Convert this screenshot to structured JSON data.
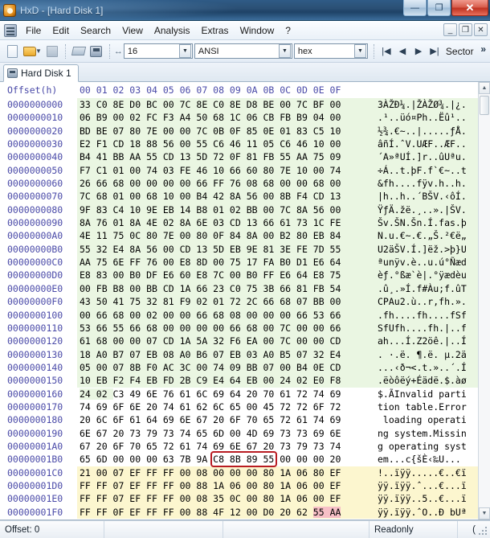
{
  "window": {
    "title": "HxD - [Hard Disk 1]",
    "app_icon": "hxd-app-icon",
    "buttons": {
      "minimize": "—",
      "maximize": "❐",
      "close": "✕"
    }
  },
  "menubar": {
    "items": [
      "File",
      "Edit",
      "Search",
      "View",
      "Analysis",
      "Extras",
      "Window",
      "?"
    ],
    "mdi_buttons": {
      "minimize": "_",
      "restore": "❐",
      "close": "✕"
    }
  },
  "toolbar": {
    "icons": [
      "new-file-icon",
      "open-file-icon",
      "save-icon",
      "open-ram-icon",
      "open-disk-icon",
      "bytes-per-row-icon"
    ],
    "bytes_per_row": {
      "value": "16",
      "label": "bytes per row"
    },
    "charset": {
      "value": "ANSI",
      "label": "character set"
    },
    "base": {
      "value": "hex",
      "label": "offset base"
    },
    "nav": {
      "first": "|◀",
      "prev": "◀",
      "next": "▶",
      "last": "▶|"
    },
    "sector_label": "Sector",
    "overflow": "»"
  },
  "tabs": [
    {
      "label": "Hard Disk 1",
      "icon": "disk-icon",
      "active": true
    }
  ],
  "hexview": {
    "header": {
      "offset_label": "Offset(h)",
      "columns": [
        "00",
        "01",
        "02",
        "03",
        "04",
        "05",
        "06",
        "07",
        "08",
        "09",
        "0A",
        "0B",
        "0C",
        "0D",
        "0E",
        "0F"
      ]
    },
    "rows": [
      {
        "offset": "0000000000",
        "hex": "33 C0 8E D0 BC 00 7C 8E C0 8E D8 BE 00 7C BF 00",
        "ascii": "3ÀŽÐ¼.|ŽÀŽØ¾.|¿.",
        "tint": "green"
      },
      {
        "offset": "0000000010",
        "hex": "06 B9 00 02 FC F3 A4 50 68 1C 06 CB FB B9 04 00",
        "ascii": ".¹..üó¤Ph..Ëû¹..",
        "tint": "green"
      },
      {
        "offset": "0000000020",
        "hex": "BD BE 07 80 7E 00 00 7C 0B 0F 85 0E 01 83 C5 10",
        "ascii": "½¾.€~..|.....ƒÅ.",
        "tint": "green"
      },
      {
        "offset": "0000000030",
        "hex": "E2 F1 CD 18 88 56 00 55 C6 46 11 05 C6 46 10 00",
        "ascii": "âñÍ.ˆV.UÆF..ÆF..",
        "tint": "green"
      },
      {
        "offset": "0000000040",
        "hex": "B4 41 BB AA 55 CD 13 5D 72 0F 81 FB 55 AA 75 09",
        "ascii": "´A»ªUÍ.]r..ûUªu.",
        "tint": "green"
      },
      {
        "offset": "0000000050",
        "hex": "F7 C1 01 00 74 03 FE 46 10 66 60 80 7E 10 00 74",
        "ascii": "÷Á..t.þF.f`€~..t",
        "tint": "green"
      },
      {
        "offset": "0000000060",
        "hex": "26 66 68 00 00 00 00 66 FF 76 08 68 00 00 68 00",
        "ascii": "&fh....fÿv.h..h.",
        "tint": "green"
      },
      {
        "offset": "0000000070",
        "hex": "7C 68 01 00 68 10 00 B4 42 8A 56 00 8B F4 CD 13",
        "ascii": "|h..h..´BŠV.‹ôÍ.",
        "tint": "green"
      },
      {
        "offset": "0000000080",
        "hex": "9F 83 C4 10 9E EB 14 B8 01 02 BB 00 7C 8A 56 00",
        "ascii": "ŸƒÄ.žë.¸..».|ŠV.",
        "tint": "green"
      },
      {
        "offset": "0000000090",
        "hex": "8A 76 01 8A 4E 02 8A 6E 03 CD 13 66 61 73 1C FE",
        "ascii": "Šv.ŠN.Šn.Í.fas.þ",
        "tint": "green"
      },
      {
        "offset": "00000000A0",
        "hex": "4E 11 75 0C 80 7E 00 80 0F 84 8A 00 B2 80 EB 84",
        "ascii": "N.u.€~.€.„Š.²€ë„",
        "tint": "green"
      },
      {
        "offset": "00000000B0",
        "hex": "55 32 E4 8A 56 00 CD 13 5D EB 9E 81 3E FE 7D 55",
        "ascii": "U2äŠV.Í.]ëž.>þ}U",
        "tint": "green"
      },
      {
        "offset": "00000000C0",
        "hex": "AA 75 6E FF 76 00 E8 8D 00 75 17 FA B0 D1 E6 64",
        "ascii": "ªunÿv.è..u.ú°Ñæd",
        "tint": "green"
      },
      {
        "offset": "00000000D0",
        "hex": "E8 83 00 B0 DF E6 60 E8 7C 00 B0 FF E6 64 E8 75",
        "ascii": "èƒ.°ßæ`è|.°ÿædèu",
        "tint": "green"
      },
      {
        "offset": "00000000E0",
        "hex": "00 FB B8 00 BB CD 1A 66 23 C0 75 3B 66 81 FB 54",
        "ascii": ".û¸.»Í.f#Àu;f.ûT",
        "tint": "green"
      },
      {
        "offset": "00000000F0",
        "hex": "43 50 41 75 32 81 F9 02 01 72 2C 66 68 07 BB 00",
        "ascii": "CPAu2.ù..r,fh.».",
        "tint": "green"
      },
      {
        "offset": "0000000100",
        "hex": "00 66 68 00 02 00 00 66 68 08 00 00 00 66 53 66",
        "ascii": ".fh....fh....fSf",
        "tint": "green"
      },
      {
        "offset": "0000000110",
        "hex": "53 66 55 66 68 00 00 00 00 66 68 00 7C 00 00 66",
        "ascii": "SfUfh....fh.|..f",
        "tint": "green"
      },
      {
        "offset": "0000000120",
        "hex": "61 68 00 00 07 CD 1A 5A 32 F6 EA 00 7C 00 00 CD",
        "ascii": "ah...Í.Z2öê.|..Í",
        "tint": "green"
      },
      {
        "offset": "0000000130",
        "hex": "18 A0 B7 07 EB 08 A0 B6 07 EB 03 A0 B5 07 32 E4",
        "ascii": ". ·.ë. ¶.ë. µ.2ä",
        "tint": "green"
      },
      {
        "offset": "0000000140",
        "hex": "05 00 07 8B F0 AC 3C 00 74 09 BB 07 00 B4 0E CD",
        "ascii": "...‹ð¬<.t.»..´.Í",
        "tint": "green"
      },
      {
        "offset": "0000000150",
        "hex": "10 EB F2 F4 EB FD 2B C9 E4 64 EB 00 24 02 E0 F8",
        "ascii": ".ëòôëý+Éädë.$.àø",
        "tint": "green"
      },
      {
        "offset": "0000000160",
        "hex": "24 02 C3 49 6E 76 61 6C 69 64 20 70 61 72 74 69",
        "ascii": "$.ÃInvalid parti",
        "tint": "green-partial"
      },
      {
        "offset": "0000000170",
        "hex": "74 69 6F 6E 20 74 61 62 6C 65 00 45 72 72 6F 72",
        "ascii": "tion table.Error",
        "tint": "none"
      },
      {
        "offset": "0000000180",
        "hex": "20 6C 6F 61 64 69 6E 67 20 6F 70 65 72 61 74 69",
        "ascii": " loading operati",
        "tint": "none"
      },
      {
        "offset": "0000000190",
        "hex": "6E 67 20 73 79 73 74 65 6D 00 4D 69 73 73 69 6E",
        "ascii": "ng system.Missin",
        "tint": "none"
      },
      {
        "offset": "00000001A0",
        "hex": "67 20 6F 70 65 72 61 74 69 6E 67 20 73 79 73 74",
        "ascii": "g operating syst",
        "tint": "none"
      },
      {
        "offset": "00000001B0",
        "hex": "65 6D 00 00 00 63 7B 9A C8 8B 89 55 00 00 00 20",
        "ascii": "em...c{šÈ‹‰U...",
        "tint": "none"
      },
      {
        "offset": "00000001C0",
        "hex": "21 00 07 EF FF FF 00 08 00 00 00 80 1A 06 80 EF",
        "ascii": "!..ïÿÿ.....€..€ï",
        "tint": "yellow"
      },
      {
        "offset": "00000001D0",
        "hex": "FF FF 07 EF FF FF 00 88 1A 06 00 80 1A 06 00 EF",
        "ascii": "ÿÿ.ïÿÿ.ˆ...€...ï",
        "tint": "yellow"
      },
      {
        "offset": "00000001E0",
        "hex": "FF FF 07 EF FF FF 00 08 35 0C 00 80 1A 06 00 EF",
        "ascii": "ÿÿ.ïÿÿ..5..€...ï",
        "tint": "yellow"
      },
      {
        "offset": "00000001F0",
        "hex": "FF FF 0F EF FF FF 00 88 4F 12 00 D0 20 62 55 AA",
        "ascii": "ÿÿ.ïÿÿ.ˆO..Ð bUª",
        "tint": "yellow",
        "sig_highlight": true
      }
    ],
    "annotation": {
      "name": "disk-signature-redbox",
      "description": "red rectangle around disk signature bytes"
    },
    "scrollbar": {
      "up": "▲",
      "down": "▼"
    }
  },
  "statusbar": {
    "offset": "Offset: 0",
    "field2": "",
    "field3": "",
    "mode": "Readonly",
    "overwrite": "("
  }
}
